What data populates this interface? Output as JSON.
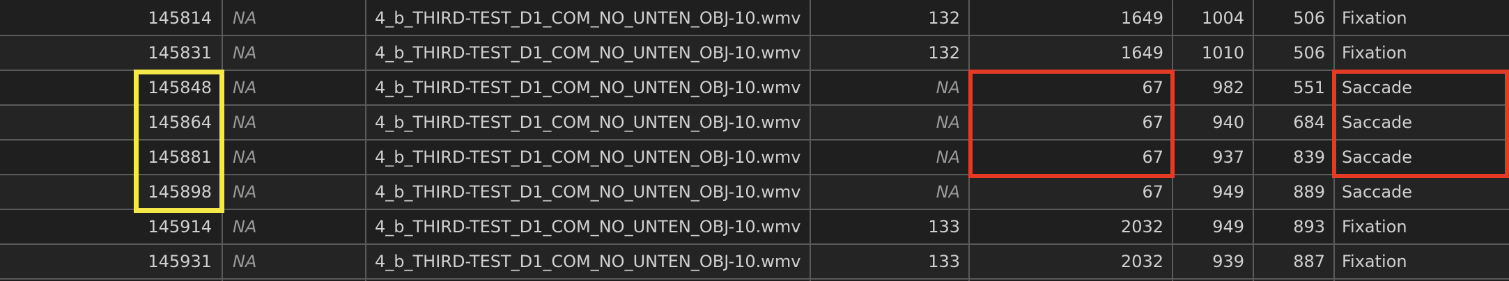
{
  "rows": [
    {
      "time": "145814",
      "col2": "NA",
      "media": "4_b_THIRD-TEST_D1_COM_NO_UNTEN_OBJ-10.wmv",
      "index": "132",
      "duration": "1649",
      "x": "1004",
      "y": "506",
      "type": "Fixation"
    },
    {
      "time": "145831",
      "col2": "NA",
      "media": "4_b_THIRD-TEST_D1_COM_NO_UNTEN_OBJ-10.wmv",
      "index": "132",
      "duration": "1649",
      "x": "1010",
      "y": "506",
      "type": "Fixation"
    },
    {
      "time": "145848",
      "col2": "NA",
      "media": "4_b_THIRD-TEST_D1_COM_NO_UNTEN_OBJ-10.wmv",
      "index": "NA",
      "duration": "67",
      "x": "982",
      "y": "551",
      "type": "Saccade"
    },
    {
      "time": "145864",
      "col2": "NA",
      "media": "4_b_THIRD-TEST_D1_COM_NO_UNTEN_OBJ-10.wmv",
      "index": "NA",
      "duration": "67",
      "x": "940",
      "y": "684",
      "type": "Saccade"
    },
    {
      "time": "145881",
      "col2": "NA",
      "media": "4_b_THIRD-TEST_D1_COM_NO_UNTEN_OBJ-10.wmv",
      "index": "NA",
      "duration": "67",
      "x": "937",
      "y": "839",
      "type": "Saccade"
    },
    {
      "time": "145898",
      "col2": "NA",
      "media": "4_b_THIRD-TEST_D1_COM_NO_UNTEN_OBJ-10.wmv",
      "index": "NA",
      "duration": "67",
      "x": "949",
      "y": "889",
      "type": "Saccade"
    },
    {
      "time": "145914",
      "col2": "NA",
      "media": "4_b_THIRD-TEST_D1_COM_NO_UNTEN_OBJ-10.wmv",
      "index": "133",
      "duration": "2032",
      "x": "949",
      "y": "893",
      "type": "Fixation"
    },
    {
      "time": "145931",
      "col2": "NA",
      "media": "4_b_THIRD-TEST_D1_COM_NO_UNTEN_OBJ-10.wmv",
      "index": "133",
      "duration": "2032",
      "x": "939",
      "y": "887",
      "type": "Fixation"
    }
  ],
  "colors": {
    "yellow_highlight": "#f5e94a",
    "red_highlight": "#e33b26"
  }
}
